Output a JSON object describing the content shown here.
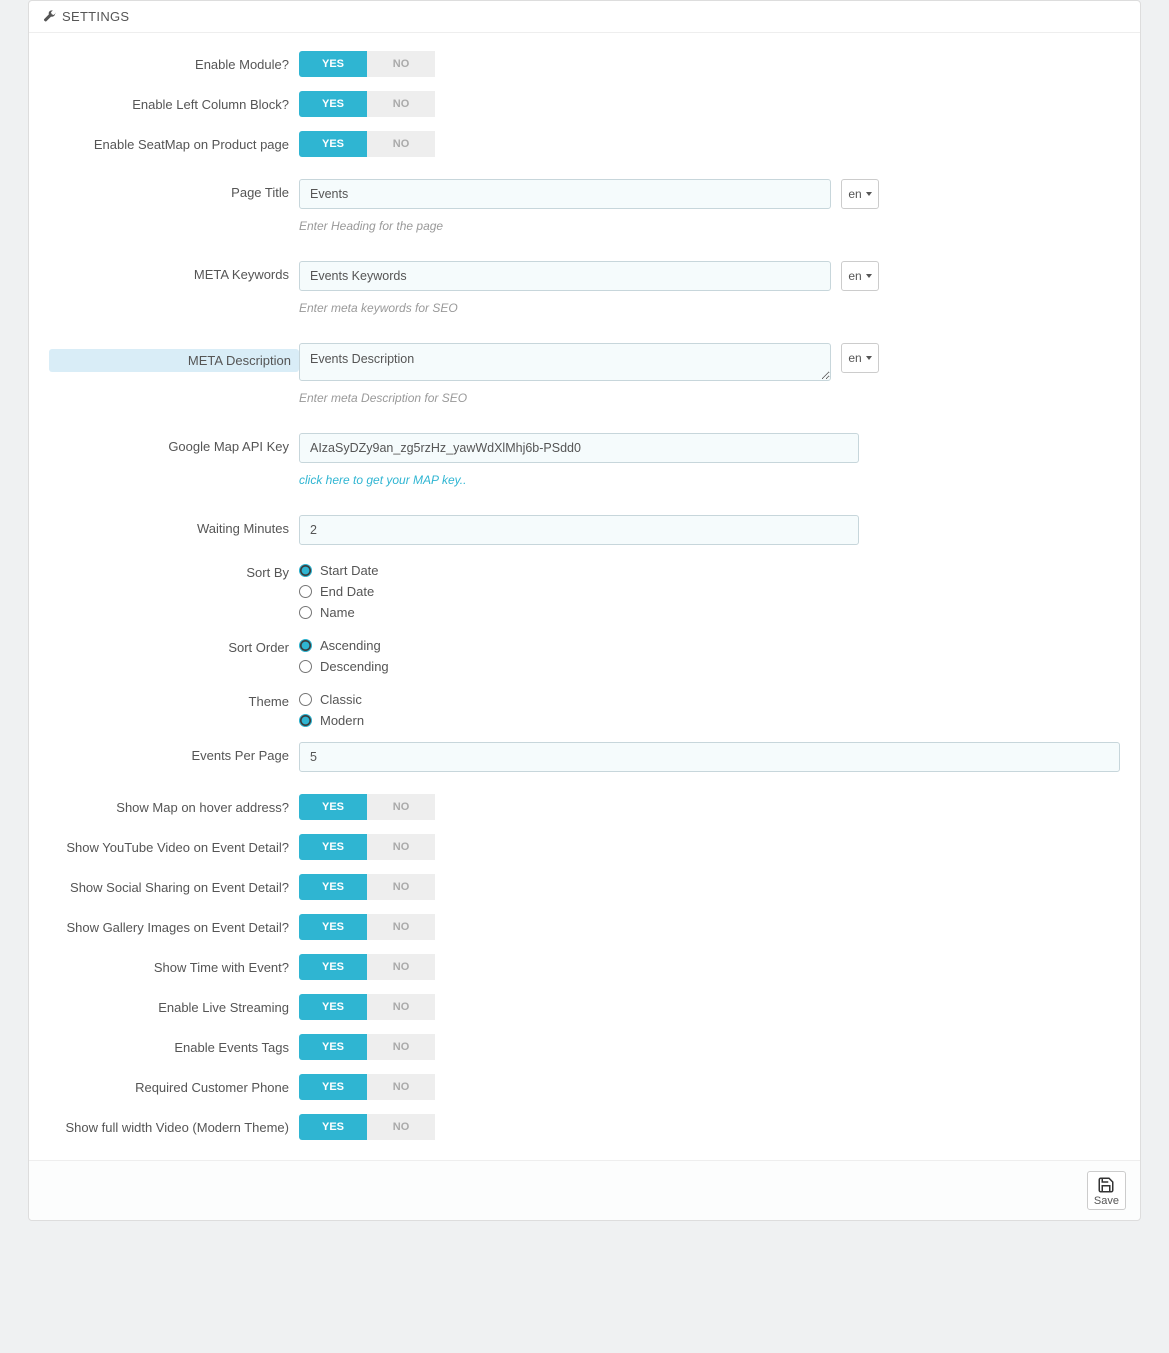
{
  "panel": {
    "title": "SETTINGS"
  },
  "lang": "en",
  "toggles": {
    "enable_module": {
      "label": "Enable Module?",
      "yes": "YES",
      "no": "NO"
    },
    "enable_left_column": {
      "label": "Enable Left Column Block?",
      "yes": "YES",
      "no": "NO"
    },
    "enable_seatmap": {
      "label": "Enable SeatMap on Product page",
      "yes": "YES",
      "no": "NO"
    },
    "show_map_hover": {
      "label": "Show Map on hover address?",
      "yes": "YES",
      "no": "NO"
    },
    "show_youtube": {
      "label": "Show YouTube Video on Event Detail?",
      "yes": "YES",
      "no": "NO"
    },
    "show_social": {
      "label": "Show Social Sharing on Event Detail?",
      "yes": "YES",
      "no": "NO"
    },
    "show_gallery": {
      "label": "Show Gallery Images on Event Detail?",
      "yes": "YES",
      "no": "NO"
    },
    "show_time": {
      "label": "Show Time with Event?",
      "yes": "YES",
      "no": "NO"
    },
    "enable_live": {
      "label": "Enable Live Streaming",
      "yes": "YES",
      "no": "NO"
    },
    "enable_tags": {
      "label": "Enable Events Tags",
      "yes": "YES",
      "no": "NO"
    },
    "required_phone": {
      "label": "Required Customer Phone",
      "yes": "YES",
      "no": "NO"
    },
    "full_width_video": {
      "label": "Show full width Video (Modern Theme)",
      "yes": "YES",
      "no": "NO"
    }
  },
  "fields": {
    "page_title": {
      "label": "Page Title",
      "value": "Events",
      "hint": "Enter Heading for the page"
    },
    "meta_keywords": {
      "label": "META Keywords",
      "value": "Events Keywords",
      "hint": "Enter meta keywords for SEO"
    },
    "meta_description": {
      "label": "META Description",
      "value": "Events Description",
      "hint": "Enter meta Description for SEO"
    },
    "gmap_key": {
      "label": "Google Map API Key",
      "value": "AIzaSyDZy9an_zg5rzHz_yawWdXlMhj6b-PSdd0",
      "hint": "click here to get your MAP key.."
    },
    "waiting_minutes": {
      "label": "Waiting Minutes",
      "value": "2"
    },
    "events_per_page": {
      "label": "Events Per Page",
      "value": "5"
    }
  },
  "sort_by": {
    "label": "Sort By",
    "options": {
      "start": "Start Date",
      "end": "End Date",
      "name": "Name"
    },
    "value": "start"
  },
  "sort_order": {
    "label": "Sort Order",
    "options": {
      "asc": "Ascending",
      "desc": "Descending"
    },
    "value": "asc"
  },
  "theme": {
    "label": "Theme",
    "options": {
      "classic": "Classic",
      "modern": "Modern"
    },
    "value": "modern"
  },
  "footer": {
    "save": "Save"
  }
}
